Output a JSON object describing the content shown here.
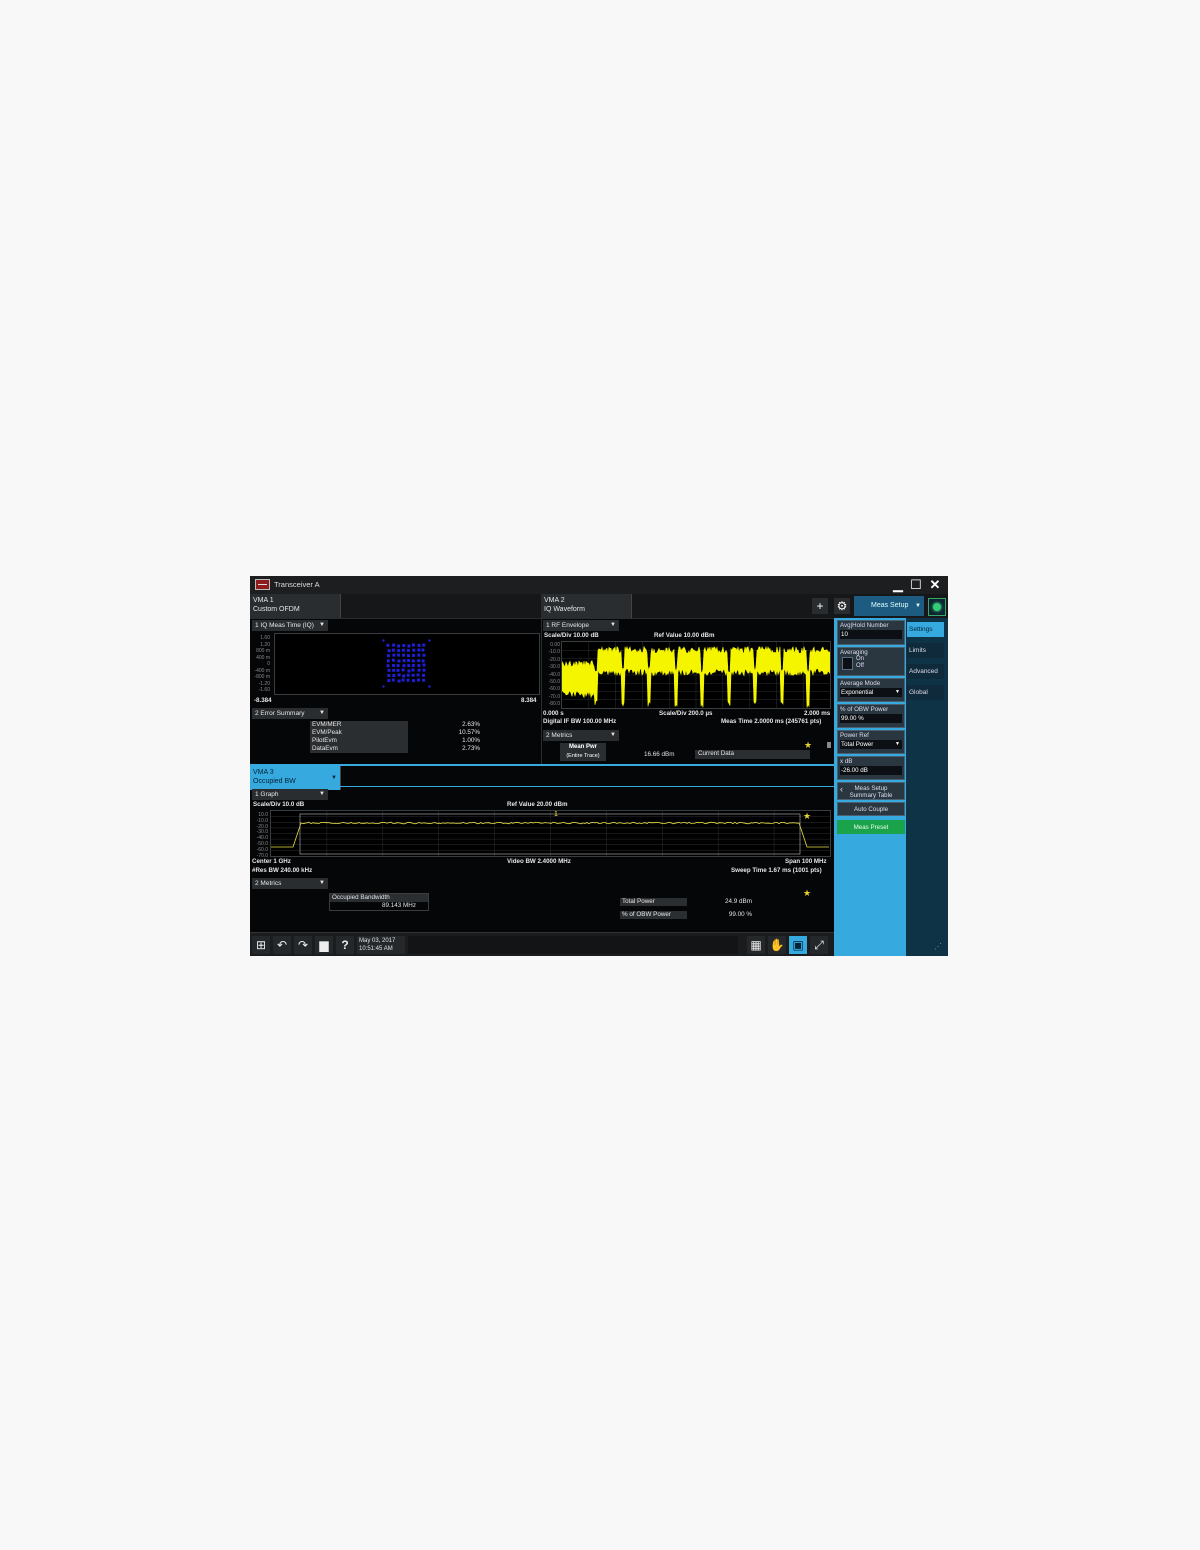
{
  "window": {
    "title": "Transceiver A"
  },
  "screens": [
    {
      "line1": "VMA 1",
      "line2": "Custom OFDM"
    },
    {
      "line1": "VMA 2",
      "line2": "IQ Waveform"
    },
    {
      "line1": "VMA 3",
      "line2": "Occupied BW"
    }
  ],
  "toolbar": {
    "meas_setup": "Meas Setup"
  },
  "vma1": {
    "window1": {
      "title": "1 IQ Meas Time (IQ)",
      "y_ticks": [
        "1.60",
        "1.20",
        "800 m",
        "400 m",
        "0",
        "-400 m",
        "-800 m",
        "-1.20",
        "-1.60"
      ],
      "x_left": "-8.384",
      "x_right": "8.384"
    },
    "window2": {
      "title": "2 Error Summary",
      "rows": [
        {
          "name": "EVM/MER",
          "value": "2.63%"
        },
        {
          "name": "EVM/Peak",
          "value": "10.57%"
        },
        {
          "name": "PilotEvm",
          "value": "1.00%"
        },
        {
          "name": "DataEvm",
          "value": "2.73%"
        }
      ]
    }
  },
  "vma2": {
    "window1": {
      "title": "1 RF Envelope",
      "scale": "Scale/Div 10.00 dB",
      "ref": "Ref Value 10.00 dBm",
      "y_ticks": [
        "0.00",
        "-10.0",
        "-20.0",
        "-30.0",
        "-40.0",
        "-50.0",
        "-60.0",
        "-70.0",
        "-80.0"
      ],
      "x_start": "0.000 s",
      "x_scale": "Scale/Div 200.0 µs",
      "x_end": "2.000 ms",
      "bottom_left": "Digital IF BW 100.00 MHz",
      "bottom_right": "Meas Time 2.0000 ms (245761 pts)"
    },
    "window2": {
      "title": "2 Metrics",
      "header": "Mean Pwr",
      "sub": "(Entire Trace)",
      "value": "16.66 dBm",
      "col": "Current Data"
    }
  },
  "vma3": {
    "graph": {
      "title": "1 Graph",
      "scale": "Scale/Div 10.0 dB",
      "ref": "Ref Value 20.00 dBm",
      "y_ticks": [
        "10.0",
        "-10.0",
        "-20.0",
        "-30.0",
        "-40.0",
        "-50.0",
        "-60.0",
        "-70.0"
      ],
      "center": "Center 1 GHz",
      "vbw": "Video BW 2.4000 MHz",
      "span": "Span 100 MHz",
      "rbw": "#Res BW 240.00 kHz",
      "sweep": "Sweep Time 1.67 ms (1001 pts)",
      "marker": "1"
    },
    "metrics": {
      "title": "2 Metrics",
      "occ_bw_label": "Occupied Bandwidth",
      "occ_bw_value": "89.143 MHz",
      "total_power_label": "Total Power",
      "total_power_value": "24.9 dBm",
      "obw_power_label": "% of OBW Power",
      "obw_power_value": "99.00 %"
    }
  },
  "softkeys": {
    "avg_hold_label": "Avg|Hold Number",
    "avg_hold_value": "10",
    "averaging_label": "Averaging",
    "averaging_on": "On",
    "averaging_off": "Off",
    "avg_mode_label": "Average Mode",
    "avg_mode_value": "Exponential",
    "obw_power_label": "% of OBW Power",
    "obw_power_value": "99.00 %",
    "power_ref_label": "Power Ref",
    "power_ref_value": "Total Power",
    "xdb_label": "x dB",
    "xdb_value": "-26.00 dB",
    "summary_line1": "Meas Setup",
    "summary_line2": "Summary Table",
    "auto_couple": "Auto Couple",
    "meas_preset": "Meas Preset"
  },
  "side_tabs": [
    "Settings",
    "Limits",
    "Advanced",
    "Global"
  ],
  "taskbar": {
    "date": "May 03, 2017",
    "time": "10:51:45 AM"
  },
  "colors": {
    "accent": "#36a9df",
    "trace_yellow": "#f5f500",
    "constellation_blue": "#1f1fd8",
    "preset_green": "#1aa34a"
  }
}
